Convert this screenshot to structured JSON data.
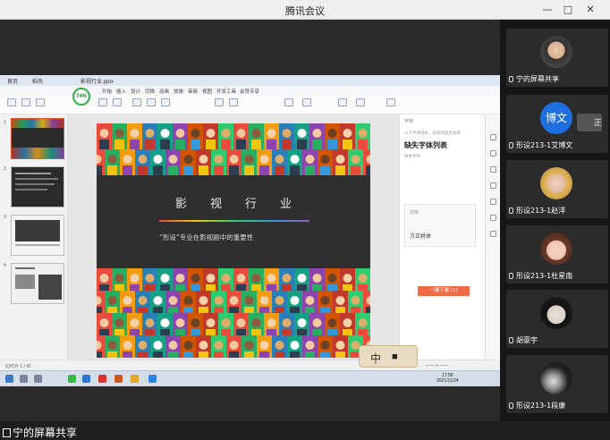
{
  "window": {
    "title": "腾讯会议",
    "controls": [
      "—",
      "□",
      "✕"
    ]
  },
  "wps": {
    "app_tabs": [
      "首页",
      "稻壳",
      "影视行业.pptx"
    ],
    "menu": [
      "开始",
      "插入",
      "设计",
      "切换",
      "动画",
      "放映",
      "审阅",
      "视图",
      "开发工具",
      "会员专享"
    ],
    "zoom_badge": "74%",
    "slide_numbers": [
      "1",
      "2",
      "3",
      "4"
    ],
    "status_left": "幻灯片 1 / 41",
    "status_right": "—— + ——"
  },
  "slide": {
    "title": "影视行业",
    "subtitle": "“形设”专业在影视剧中的重要性"
  },
  "panel": {
    "header": "字体",
    "heading": "缺失字体列表",
    "hint1": "以下字体缺失，会影响显示效果",
    "hint2": "缺失字体",
    "box_label": "仿宋",
    "font_name": "方正姚体",
    "fix_button": "一键下载 (1)"
  },
  "taskbar": {
    "time": "17:56",
    "date": "2021/11/24"
  },
  "ime": {
    "mode": "中"
  },
  "own_share_label": "宁的屏幕共享",
  "participants": [
    {
      "name": "宁的屏幕共享",
      "avatar": "photo"
    },
    {
      "name": "形设213-1艾博文",
      "avatar": "text",
      "avatar_text": "博文"
    },
    {
      "name": "形设213-1赵洋",
      "avatar": "photo"
    },
    {
      "name": "形设213-1杜星南",
      "avatar": "photo"
    },
    {
      "name": "胡豪宇",
      "avatar": "photo"
    },
    {
      "name": "形设213-1段康",
      "avatar": "photo"
    }
  ],
  "overflow_avatar": "正"
}
